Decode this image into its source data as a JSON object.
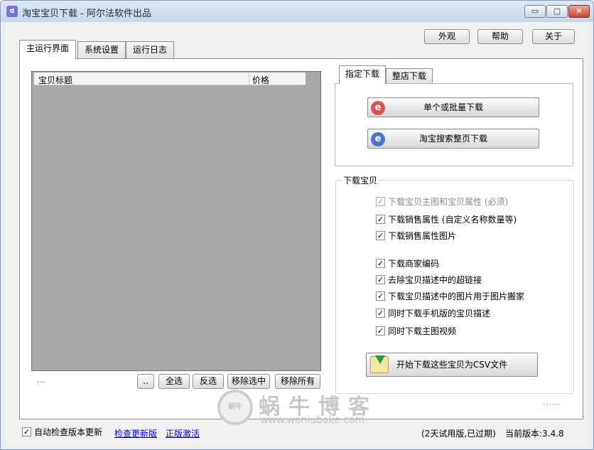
{
  "window": {
    "app_icon": "app-icon",
    "title": "淘宝宝贝下载 - 阿尔法软件出品",
    "minimize": "▭",
    "maximize": "▢",
    "close": "✕"
  },
  "toolbar": {
    "appearance_label": "外观",
    "help_label": "帮助",
    "about_label": "关于"
  },
  "tabs": [
    "主运行界面",
    "系统设置",
    "运行日志"
  ],
  "table": {
    "col_title": "宝贝标题",
    "col_price": "价格"
  },
  "left_buttons": {
    "dots": "..",
    "select_all": "全选",
    "invert": "反选",
    "remove_selected": "移除选中",
    "remove_all": "移除所有"
  },
  "left_ellipsis": "...",
  "right_ellipsis": "......",
  "download_tabs": [
    "指定下载",
    "整店下载"
  ],
  "download_buttons": {
    "single": "单个或批量下载",
    "search": "淘宝搜索整页下载",
    "icon": "ie-icon",
    "icon_char": "e"
  },
  "download_options": {
    "group_title": "下载宝贝",
    "items": [
      {
        "label": "下载宝贝主图和宝贝属性 (必须)",
        "checked": true,
        "disabled": true
      },
      {
        "label": "下载销售属性 (自定义名称数量等)",
        "checked": true,
        "disabled": false
      },
      {
        "label": "下载销售属性图片",
        "checked": true,
        "disabled": false
      },
      {
        "label": "下载商家编码",
        "checked": true,
        "disabled": false
      },
      {
        "label": "去除宝贝描述中的超链接",
        "checked": true,
        "disabled": false
      },
      {
        "label": "下载宝贝描述中的图片用于图片搬家",
        "checked": true,
        "disabled": false
      },
      {
        "label": "同时下载手机版的宝贝描述",
        "checked": true,
        "disabled": false
      },
      {
        "label": "同时下载主图视频",
        "checked": true,
        "disabled": false
      }
    ],
    "start_button": "开始下载这些宝贝为CSV文件",
    "start_icon": "csv-download-icon"
  },
  "footer": {
    "auto_check_label": "自动检查版本更新",
    "auto_check_checked": true,
    "check_update_link": "检查更新版",
    "activate_link": "正版激活",
    "trial_status": "(2天试用版,已过期)",
    "version": "当前版本:3.4.8"
  },
  "watermark": {
    "logo_text": "蜗牛",
    "name": "蜗牛博客",
    "url": "www.woniuboke.com"
  }
}
